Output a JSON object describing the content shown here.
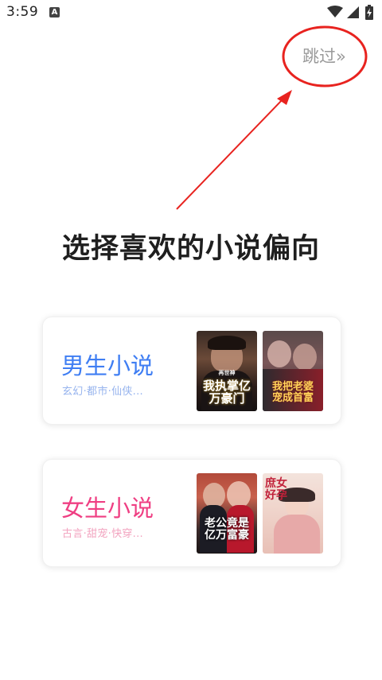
{
  "status_bar": {
    "time": "3:59",
    "notification_glyph": "A"
  },
  "skip": {
    "label": "跳过»"
  },
  "title": "选择喜欢的小说偏向",
  "categories": [
    {
      "title": "男生小说",
      "subtitle": "玄幻·都市·仙侠...",
      "covers": [
        {
          "text": "我执掌亿万豪门",
          "badge": "再世神"
        },
        {
          "text": "我把老婆宠成首富",
          "badge": ""
        }
      ]
    },
    {
      "title": "女生小说",
      "subtitle": "古言·甜宠·快穿...",
      "covers": [
        {
          "text": "老公竟是亿万富豪",
          "badge": ""
        },
        {
          "text": "庶女好孕",
          "badge": ""
        }
      ]
    }
  ],
  "colors": {
    "male_accent": "#3f7ef3",
    "female_accent": "#ef3f83",
    "annotation": "#e8231f"
  }
}
